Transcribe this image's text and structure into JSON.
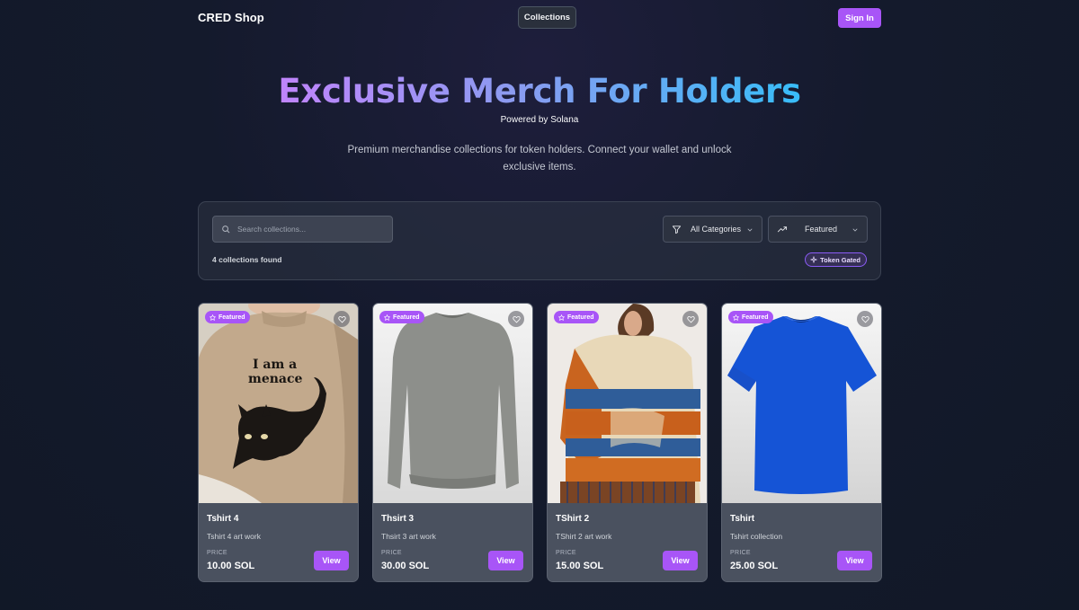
{
  "header": {
    "brand": "CRED Shop",
    "nav_center": "Collections",
    "sign_in": "Sign In"
  },
  "hero": {
    "title": "Exclusive Merch For Holders",
    "subtitle": "Powered by Solana",
    "description": "Premium merchandise collections for token holders. Connect your wallet and unlock exclusive items."
  },
  "filters": {
    "search_placeholder": "Search collections...",
    "category": "All Categories",
    "sort": "Featured",
    "count_text": "4 collections found",
    "token_gated": "Token Gated"
  },
  "colors": {
    "accent": "#a855f7",
    "background": "#111827",
    "card": "#4a515f"
  },
  "cards": [
    {
      "badge": "Featured",
      "title": "Tshirt 4",
      "description": "Tshirt 4 art work",
      "price_label": "PRICE",
      "price": "10.00 SOL",
      "button": "View",
      "image": "beige sweater with cat print",
      "image_text_1": "I am a",
      "image_text_2": "menace"
    },
    {
      "badge": "Featured",
      "title": "Thsirt 3",
      "description": "Thsirt 3 art work",
      "price_label": "PRICE",
      "price": "30.00 SOL",
      "button": "View",
      "image": "grey crewneck sweater"
    },
    {
      "badge": "Featured",
      "title": "TShirt 2",
      "description": "TShirt 2 art work",
      "price_label": "PRICE",
      "price": "15.00 SOL",
      "button": "View",
      "image": "striped knit sweater"
    },
    {
      "badge": "Featured",
      "title": "Tshirt",
      "description": "Tshirt collection",
      "price_label": "PRICE",
      "price": "25.00 SOL",
      "button": "View",
      "image": "blue t-shirt"
    }
  ]
}
